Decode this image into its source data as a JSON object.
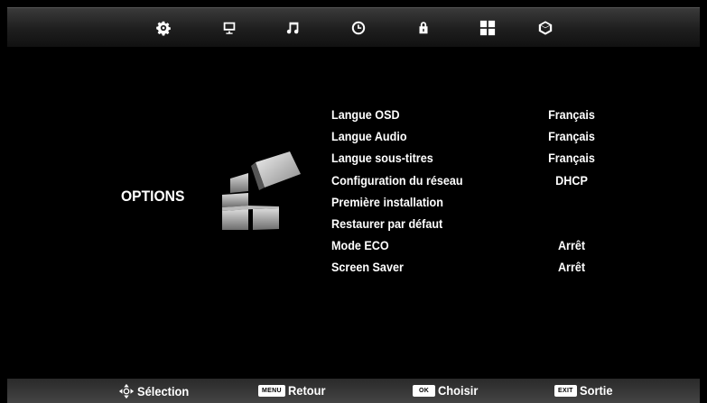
{
  "topbar": {
    "icons": [
      {
        "name": "picture-settings-icon"
      },
      {
        "name": "display-icon"
      },
      {
        "name": "music-note-icon"
      },
      {
        "name": "clock-icon"
      },
      {
        "name": "lock-icon"
      },
      {
        "name": "grid-icon"
      },
      {
        "name": "cube-options-icon"
      }
    ]
  },
  "section": {
    "title": "OPTIONS"
  },
  "menu": {
    "items": [
      {
        "label": "Langue OSD",
        "value": "Français"
      },
      {
        "label": "Langue Audio",
        "value": "Français"
      },
      {
        "label": "Langue sous-titres",
        "value": "Français"
      },
      {
        "label": "Configuration du réseau",
        "value": "DHCP"
      },
      {
        "label": "Première installation",
        "value": ""
      },
      {
        "label": "Restaurer par défaut",
        "value": ""
      },
      {
        "label": "Mode ECO",
        "value": "Arrêt"
      },
      {
        "label": "Screen Saver",
        "value": "Arrêt"
      }
    ]
  },
  "footer": {
    "select_label": "Sélection",
    "menu_key": "MENU",
    "back_label": "Retour",
    "ok_key": "OK",
    "choose_label": "Choisir",
    "exit_key": "EXIT",
    "exit_label": "Sortie"
  }
}
